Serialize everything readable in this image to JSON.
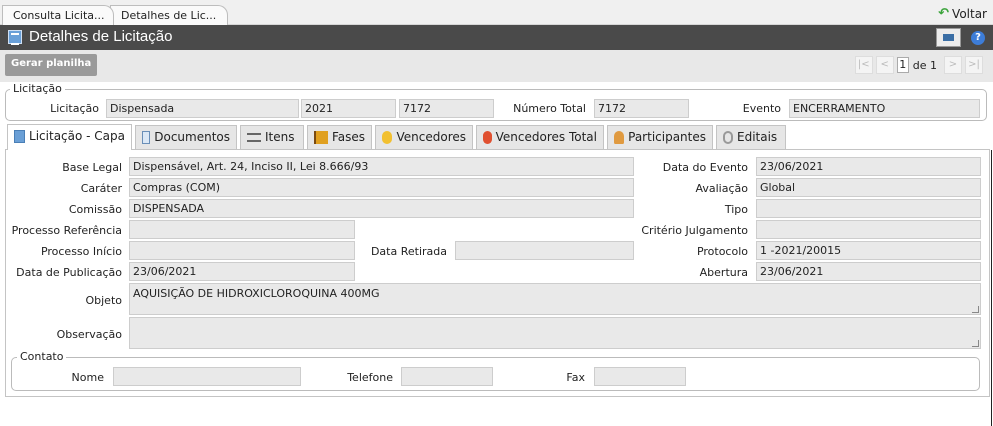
{
  "breadcrumbs": [
    "Consulta Licita...",
    "Detalhes de Lic..."
  ],
  "back_label": "Voltar",
  "title": "Detalhes de Licitação",
  "toolbar": {
    "gerar_label": "Gerar planilha"
  },
  "pager": {
    "current": "1",
    "of_label": "de 1"
  },
  "licitacao": {
    "legend": "Licitação",
    "label": "Licitação",
    "tipo": "Dispensada",
    "ano": "2021",
    "numero": "7172",
    "numero_total_label": "Número Total",
    "numero_total": "7172",
    "evento_label": "Evento",
    "evento": "ENCERRAMENTO"
  },
  "tabs": [
    "Licitação - Capa",
    "Documentos",
    "Itens",
    "Fases",
    "Vencedores",
    "Vencedores Total",
    "Participantes",
    "Editais"
  ],
  "capa": {
    "base_legal_label": "Base Legal",
    "base_legal": "Dispensável, Art. 24, Inciso II, Lei 8.666/93",
    "carater_label": "Caráter",
    "carater": "Compras (COM)",
    "comissao_label": "Comissão",
    "comissao": "DISPENSADA",
    "processo_referencia_label": "Processo Referência",
    "processo_referencia": "",
    "processo_inicio_label": "Processo Início",
    "processo_inicio": "",
    "data_retirada_label": "Data Retirada",
    "data_retirada": "",
    "data_publicacao_label": "Data de Publicação",
    "data_publicacao": "23/06/2021",
    "objeto_label": "Objeto",
    "objeto": "AQUISIÇÃO DE HIDROXICLOROQUINA 400MG",
    "observacao_label": "Observação",
    "observacao": "",
    "data_evento_label": "Data do Evento",
    "data_evento": "23/06/2021",
    "avaliacao_label": "Avaliação",
    "avaliacao": "Global",
    "tipo_label": "Tipo",
    "tipo": "",
    "criterio_label": "Critério Julgamento",
    "criterio": "",
    "protocolo_label": "Protocolo",
    "protocolo": "1 -2021/20015",
    "abertura_label": "Abertura",
    "abertura": "23/06/2021"
  },
  "contato": {
    "legend": "Contato",
    "nome_label": "Nome",
    "nome": "",
    "telefone_label": "Telefone",
    "telefone": "",
    "fax_label": "Fax",
    "fax": ""
  }
}
